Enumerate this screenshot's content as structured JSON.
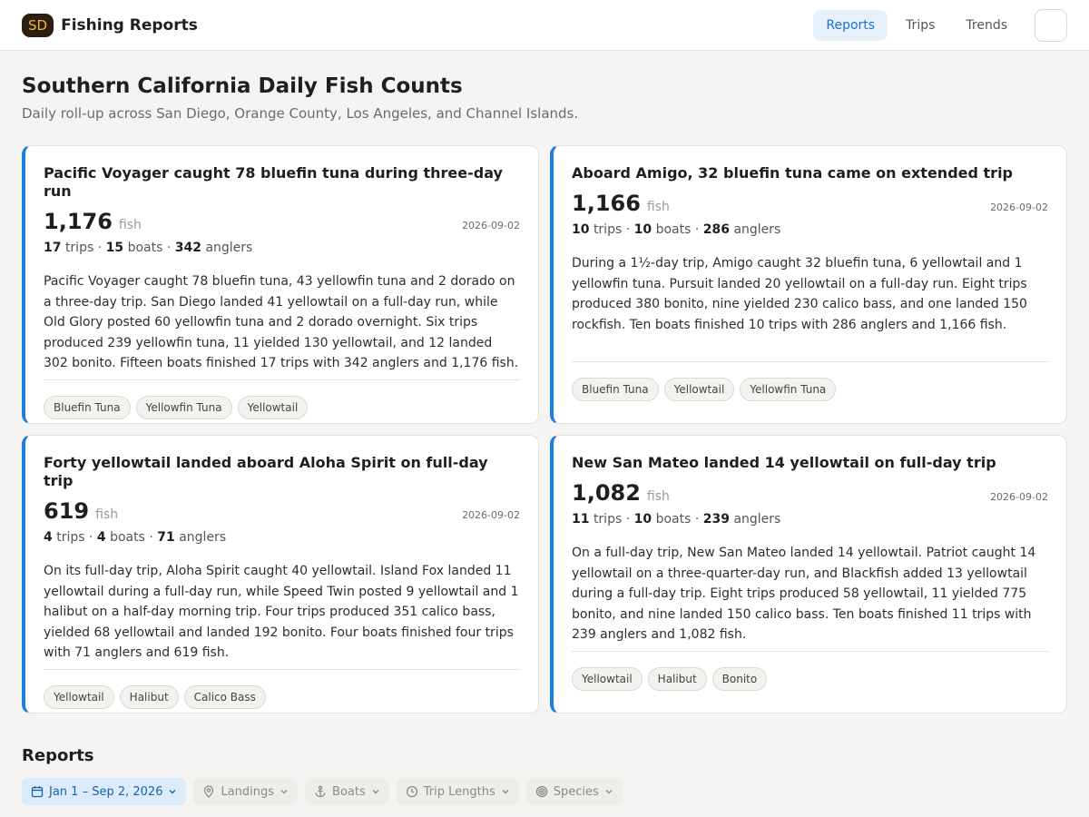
{
  "header": {
    "logo": "SD",
    "title": "Fishing Reports",
    "nav": [
      "Reports",
      "Trips",
      "Trends"
    ]
  },
  "page": {
    "title": "Southern California Daily Fish Counts",
    "subtitle": "Daily roll-up across San Diego, Orange County, Los Angeles, and Channel Islands."
  },
  "cards": [
    {
      "title": "Pacific Voyager caught 78 bluefin tuna during three-day run",
      "count": "1,176",
      "unit": "fish",
      "date": "2026-09-02",
      "trips": "17",
      "trips_label": "trips",
      "boats": "15",
      "boats_label": "boats",
      "anglers": "342",
      "anglers_label": "anglers",
      "summary": "Pacific Voyager caught 78 bluefin tuna, 43 yellowfin tuna and 2 dorado on a three-day trip. San Diego landed 41 yellowtail on a full-day run, while Old Glory posted 60 yellowfin tuna and 2 dorado overnight. Six trips produced 239 yellowfin tuna, 11 yielded 130 yellowtail, and 12 landed 302 bonito. Fifteen boats finished 17 trips with 342 anglers and 1,176 fish.",
      "tags": [
        "Bluefin Tuna",
        "Yellowfin Tuna",
        "Yellowtail"
      ]
    },
    {
      "title": "Aboard Amigo, 32 bluefin tuna came on extended trip",
      "count": "1,166",
      "unit": "fish",
      "date": "2026-09-02",
      "trips": "10",
      "trips_label": "trips",
      "boats": "10",
      "boats_label": "boats",
      "anglers": "286",
      "anglers_label": "anglers",
      "summary": "During a 1½-day trip, Amigo caught 32 bluefin tuna, 6 yellowtail and 1 yellowfin tuna. Pursuit landed 20 yellowtail on a full-day run. Eight trips produced 380 bonito, nine yielded 230 calico bass, and one landed 150 rockfish. Ten boats finished 10 trips with 286 anglers and 1,166 fish.",
      "tags": [
        "Bluefin Tuna",
        "Yellowtail",
        "Yellowfin Tuna"
      ]
    },
    {
      "title": "Forty yellowtail landed aboard Aloha Spirit on full-day trip",
      "count": "619",
      "unit": "fish",
      "date": "2026-09-02",
      "trips": "4",
      "trips_label": "trips",
      "boats": "4",
      "boats_label": "boats",
      "anglers": "71",
      "anglers_label": "anglers",
      "summary": "On its full-day trip, Aloha Spirit caught 40 yellowtail. Island Fox landed 11 yellowtail during a full-day run, while Speed Twin posted 9 yellowtail and 1 halibut on a half-day morning trip. Four trips produced 351 calico bass, yielded 68 yellowtail and landed 192 bonito. Four boats finished four trips with 71 anglers and 619 fish.",
      "tags": [
        "Yellowtail",
        "Halibut",
        "Calico Bass"
      ]
    },
    {
      "title": "New San Mateo landed 14 yellowtail on full-day trip",
      "count": "1,082",
      "unit": "fish",
      "date": "2026-09-02",
      "trips": "11",
      "trips_label": "trips",
      "boats": "10",
      "boats_label": "boats",
      "anglers": "239",
      "anglers_label": "anglers",
      "summary": "On a full-day trip, New San Mateo landed 14 yellowtail. Patriot caught 14 yellowtail on a three-quarter-day run, and Blackfish added 13 yellowtail during a full-day trip. Eight trips produced 58 yellowtail, 11 yielded 775 bonito, and nine landed 150 calico bass. Ten boats finished 11 trips with 239 anglers and 1,082 fish.",
      "tags": [
        "Yellowtail",
        "Halibut",
        "Bonito"
      ]
    }
  ],
  "reports": {
    "title": "Reports",
    "filters": [
      {
        "label": "Jan 1 – Sep 2, 2026",
        "icon": "calendar-icon"
      },
      {
        "label": "Landings",
        "icon": "map-pin-icon"
      },
      {
        "label": "Boats",
        "icon": "anchor-icon"
      },
      {
        "label": "Trip Lengths",
        "icon": "clock-icon"
      },
      {
        "label": "Species",
        "icon": "target-icon"
      }
    ]
  },
  "colors": {
    "accent": "#1a7fe0",
    "nav_active_bg": "#e8f1fb",
    "logo_bg": "#2b1f12",
    "logo_fg": "#f2b233"
  }
}
